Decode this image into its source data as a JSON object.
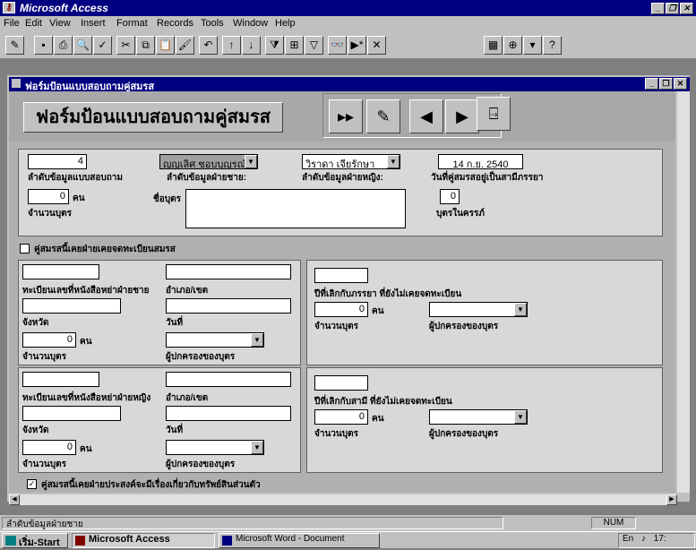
{
  "app": {
    "title": "Microsoft Access"
  },
  "menu": [
    "File",
    "Edit",
    "View",
    "Insert",
    "Format",
    "Records",
    "Tools",
    "Window",
    "Help"
  ],
  "child_window": {
    "title": "ฟอร์มป้อนแบบสอบถามคู่สมรส"
  },
  "form": {
    "header_title": "ฟอร์มป้อนแบบสอบถามคู่สมรส",
    "questionnaire_no": "4",
    "questionnaire_no_label": "ลำดับข้อมูลแบบสอบถาม",
    "husband_combo": "ญูญเลิศ ชอบบุญรณ์",
    "husband_label": "ลำดับข้อมูลฝ่ายชาย:",
    "wife_combo": "วิราดา เจียรักษา",
    "wife_label": "ลำดับข้อมูลฝ่ายหญิง:",
    "marriage_date": "14 ก.ย. 2540",
    "marriage_date_label": "วันที่คู่สมรสอยู่เป็นสามีภรรยา",
    "children_count": "0",
    "children_unit": "คน",
    "children_label": "จำนวนบุตร",
    "children_names_label": "ชื่อบุตร",
    "unborn": "0",
    "unborn_label": "บุตรในครรภ์",
    "divorce_check_label": "คู่สมรสนี้เคยฝ่ายเคยจดทะเบียนสมรส",
    "divorce_check": "",
    "husband_panel": {
      "reg_label": "ทะเบียนเลขที่หนังสือหย่าฝ่ายชาย",
      "district_label": "อำเภอ/เขต",
      "province_label": "จังหวัด",
      "date_label": "วันที่",
      "children_count": "0",
      "children_unit": "คน",
      "children_label": "จำนวนบุตร",
      "guardian_label": "ผู้ปกครองของบุตร"
    },
    "wife_unreg_panel": {
      "title_label": "ปีที่เลิกกับภรรยา ที่ยังไม่เคยจดทะเบียน",
      "children_count": "0",
      "children_unit": "คน",
      "children_label": "จำนวนบุตร",
      "guardian_label": "ผู้ปกครองของบุตร"
    },
    "wife_panel": {
      "reg_label": "ทะเบียนเลขที่หนังสือหย่าฝ่ายหญิง",
      "district_label": "อำเภอ/เขต",
      "province_label": "จังหวัด",
      "date_label": "วันที่",
      "children_count": "0",
      "children_unit": "คน",
      "children_label": "จำนวนบุตร",
      "guardian_label": "ผู้ปกครองของบุตร"
    },
    "husband_unreg_panel": {
      "title_label": "ปีที่เลิกกับสามี ที่ยังไม่เคยจดทะเบียน",
      "children_count": "0",
      "children_unit": "คน",
      "children_label": "จำนวนบุตร",
      "guardian_label": "ผู้ปกครองของบุตร"
    },
    "bottom_check_label": "คู่สมรสนี้เคยฝ่ายประสงค์จะมีเรื่องเกี่ยวกับทรัพย์สินส่วนตัว",
    "bottom_check": "✓"
  },
  "status": {
    "text": "ลำดับข้อมูลฝ่ายชาย",
    "num": "NUM"
  },
  "taskbar": {
    "start": "เริ่ม-Start",
    "task1": "Microsoft Access",
    "task2": "Microsoft Word - Document",
    "lang": "En",
    "clock": "17:"
  },
  "colors": {
    "title_blue": "#000080",
    "face": "#c0c0c0"
  }
}
